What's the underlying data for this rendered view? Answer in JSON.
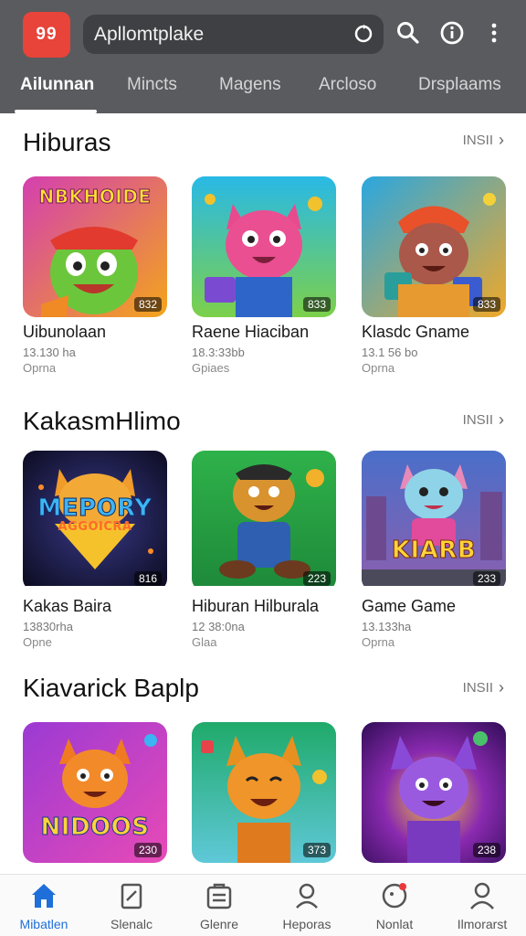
{
  "header": {
    "logo_text": "99",
    "search_text": "Apllomtplake",
    "icons": [
      "refresh-icon",
      "search-icon",
      "info-icon",
      "more-vert-icon"
    ]
  },
  "tabs": [
    {
      "label": "Ailunnan",
      "active": true
    },
    {
      "label": "Mincts",
      "active": false
    },
    {
      "label": "Magens",
      "active": false
    },
    {
      "label": "Arcloso",
      "active": false
    },
    {
      "label": "Drsplaams",
      "active": false
    }
  ],
  "sections": [
    {
      "title": "Hiburas",
      "more": "INSII",
      "cards": [
        {
          "title": "Uibunolaan",
          "meta": "13.130 ha",
          "sub": "Oprna",
          "badge": "832",
          "banner": "NBKHOIDE"
        },
        {
          "title": "Raene Hiaciban",
          "meta": "18.3:33bb",
          "sub": "Gpiaes",
          "badge": "833",
          "banner": ""
        },
        {
          "title": "Klasdc Gname",
          "meta": "13.1 56 bo",
          "sub": "Oprna",
          "badge": "833",
          "banner": ""
        }
      ]
    },
    {
      "title": "KakasmHlimo",
      "more": "INSII",
      "cards": [
        {
          "title": "Kakas Baira",
          "meta": "13830rha",
          "sub": "Opne",
          "badge": "816",
          "banner": "MEPORY",
          "banner2": "AGGOICRA"
        },
        {
          "title": "Hiburan Hilburala",
          "meta": "12 38:0na",
          "sub": "Glaa",
          "badge": "223",
          "banner": ""
        },
        {
          "title": "Game Game",
          "meta": "13.133ha",
          "sub": "Oprna",
          "badge": "233",
          "banner": "KIARB"
        }
      ]
    },
    {
      "title": "Kiavarick Baplp",
      "more": "INSII",
      "cards": [
        {
          "title": "",
          "meta": "",
          "sub": "",
          "badge": "230",
          "banner": "NIDOOS"
        },
        {
          "title": "",
          "meta": "",
          "sub": "",
          "badge": "373",
          "banner": ""
        },
        {
          "title": "",
          "meta": "",
          "sub": "",
          "badge": "238",
          "banner": ""
        }
      ]
    }
  ],
  "bottom_nav": [
    {
      "label": "Mibatlen",
      "icon": "home-icon",
      "active": true
    },
    {
      "label": "Slenalc",
      "icon": "apps-icon",
      "active": false
    },
    {
      "label": "Glenre",
      "icon": "store-icon",
      "active": false
    },
    {
      "label": "Heporas",
      "icon": "search-icon",
      "active": false
    },
    {
      "label": "Nonlat",
      "icon": "notification-icon",
      "active": false
    },
    {
      "label": "Ilmorarst",
      "icon": "profile-icon",
      "active": false
    }
  ],
  "colors": {
    "header_bg": "#5a5b5e",
    "search_bg": "#3f4043",
    "logo_bg": "#e8443a",
    "active_nav": "#1e6fd9"
  }
}
